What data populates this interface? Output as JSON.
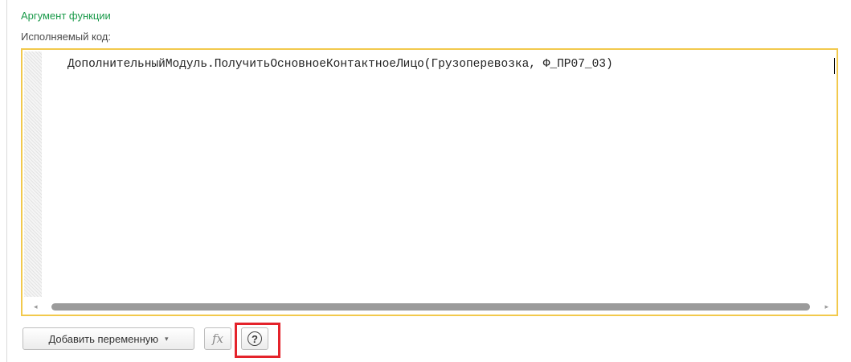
{
  "section": {
    "title": "Аргумент функции"
  },
  "field": {
    "label": "Исполняемый код:"
  },
  "editor": {
    "code": "ДополнительныйМодуль.ПолучитьОсновноеКонтактноеЛицо(Грузоперевозка, Ф_ПР07_03)",
    "scroll_left_glyph": "◂",
    "scroll_right_glyph": "▸"
  },
  "toolbar": {
    "add_variable_label": "Добавить переменную",
    "dropdown_glyph": "▾",
    "fx_label": "fx",
    "help_glyph": "?"
  },
  "colors": {
    "accent_green": "#1a9a4a",
    "editor_border": "#f2c94c",
    "highlight_red": "#e4232b"
  },
  "icons": [
    "dropdown-arrow-icon",
    "function-icon",
    "help-icon",
    "scroll-left-icon",
    "scroll-right-icon"
  ]
}
